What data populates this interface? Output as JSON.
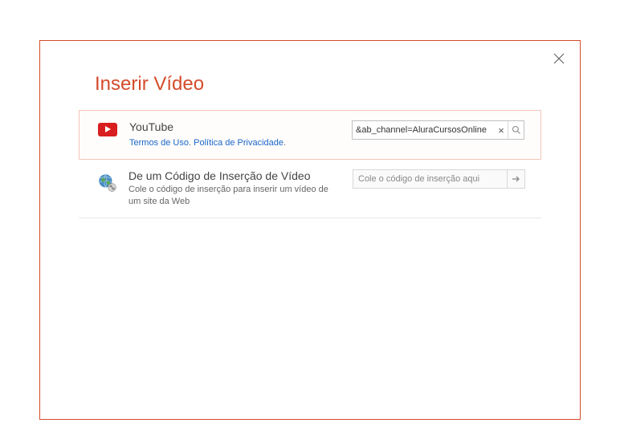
{
  "dialog": {
    "title": "Inserir Vídeo"
  },
  "youtube_option": {
    "title": "YouTube",
    "terms_link": "Termos de Uso",
    "separator": ". ",
    "privacy_link": "Política de Privacidade",
    "trailing": ".",
    "input_value": "&ab_channel=AluraCursosOnline"
  },
  "embed_option": {
    "title": "De um Código de Inserção de Vídeo",
    "subtitle": "Cole o código de inserção para inserir um vídeo de um site da Web",
    "placeholder": "Cole o código de inserção aqui"
  }
}
